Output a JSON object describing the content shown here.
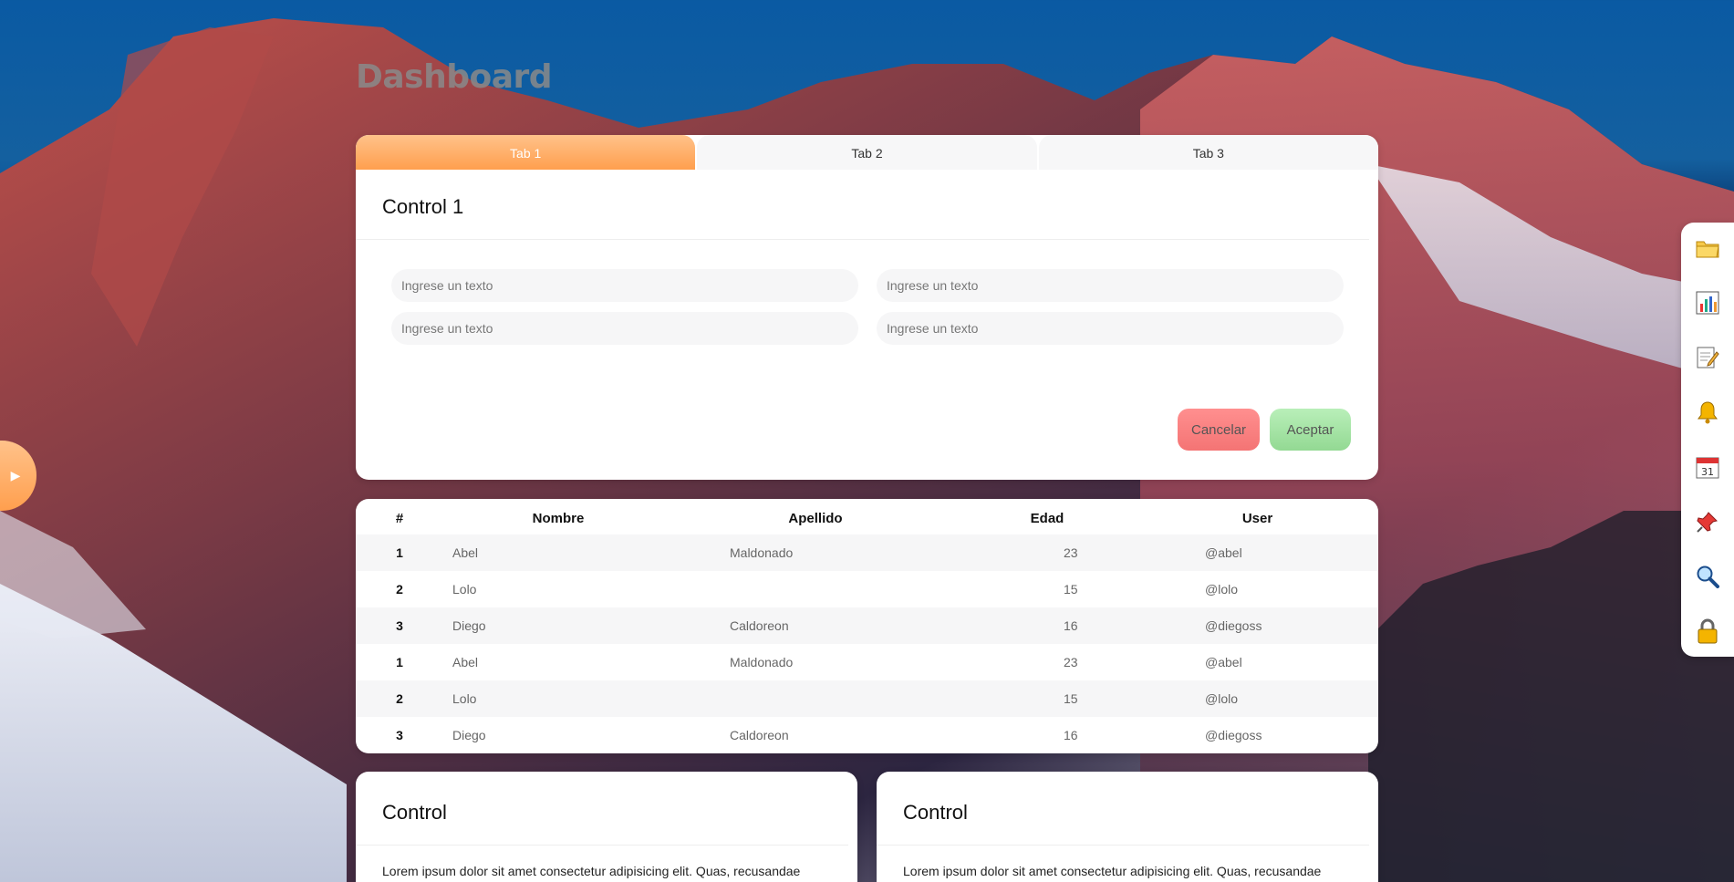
{
  "page": {
    "title": "Dashboard"
  },
  "tabs": [
    {
      "label": "Tab 1",
      "active": true
    },
    {
      "label": "Tab 2",
      "active": false
    },
    {
      "label": "Tab 3",
      "active": false
    }
  ],
  "control_panel": {
    "title": "Control 1",
    "inputs": [
      {
        "placeholder": "Ingrese un texto"
      },
      {
        "placeholder": "Ingrese un texto"
      },
      {
        "placeholder": "Ingrese un texto"
      },
      {
        "placeholder": "Ingrese un texto"
      }
    ],
    "cancel_label": "Cancelar",
    "accept_label": "Aceptar"
  },
  "table": {
    "headers": [
      "#",
      "Nombre",
      "Apellido",
      "Edad",
      "User"
    ],
    "rows": [
      [
        "1",
        "Abel",
        "Maldonado",
        "23",
        "@abel"
      ],
      [
        "2",
        "Lolo",
        "",
        "15",
        "@lolo"
      ],
      [
        "3",
        "Diego",
        "Caldoreon",
        "16",
        "@diegoss"
      ],
      [
        "1",
        "Abel",
        "Maldonado",
        "23",
        "@abel"
      ],
      [
        "2",
        "Lolo",
        "",
        "15",
        "@lolo"
      ],
      [
        "3",
        "Diego",
        "Caldoreon",
        "16",
        "@diegoss"
      ]
    ]
  },
  "bottom_cards": [
    {
      "title": "Control",
      "text": "Lorem ipsum dolor sit amet consectetur adipisicing elit. Quas, recusandae"
    },
    {
      "title": "Control",
      "text": "Lorem ipsum dolor sit amet consectetur adipisicing elit. Quas, recusandae"
    }
  ],
  "dock": {
    "icons": [
      "folder-icon",
      "bar-chart-icon",
      "memo-icon",
      "bell-icon",
      "calendar-icon",
      "pushpin-icon",
      "magnifier-icon",
      "lock-icon"
    ],
    "calendar_day": "31"
  },
  "colors": {
    "accent": "#ff9f4e",
    "cancel": "#f47474",
    "accept": "#93d993"
  }
}
